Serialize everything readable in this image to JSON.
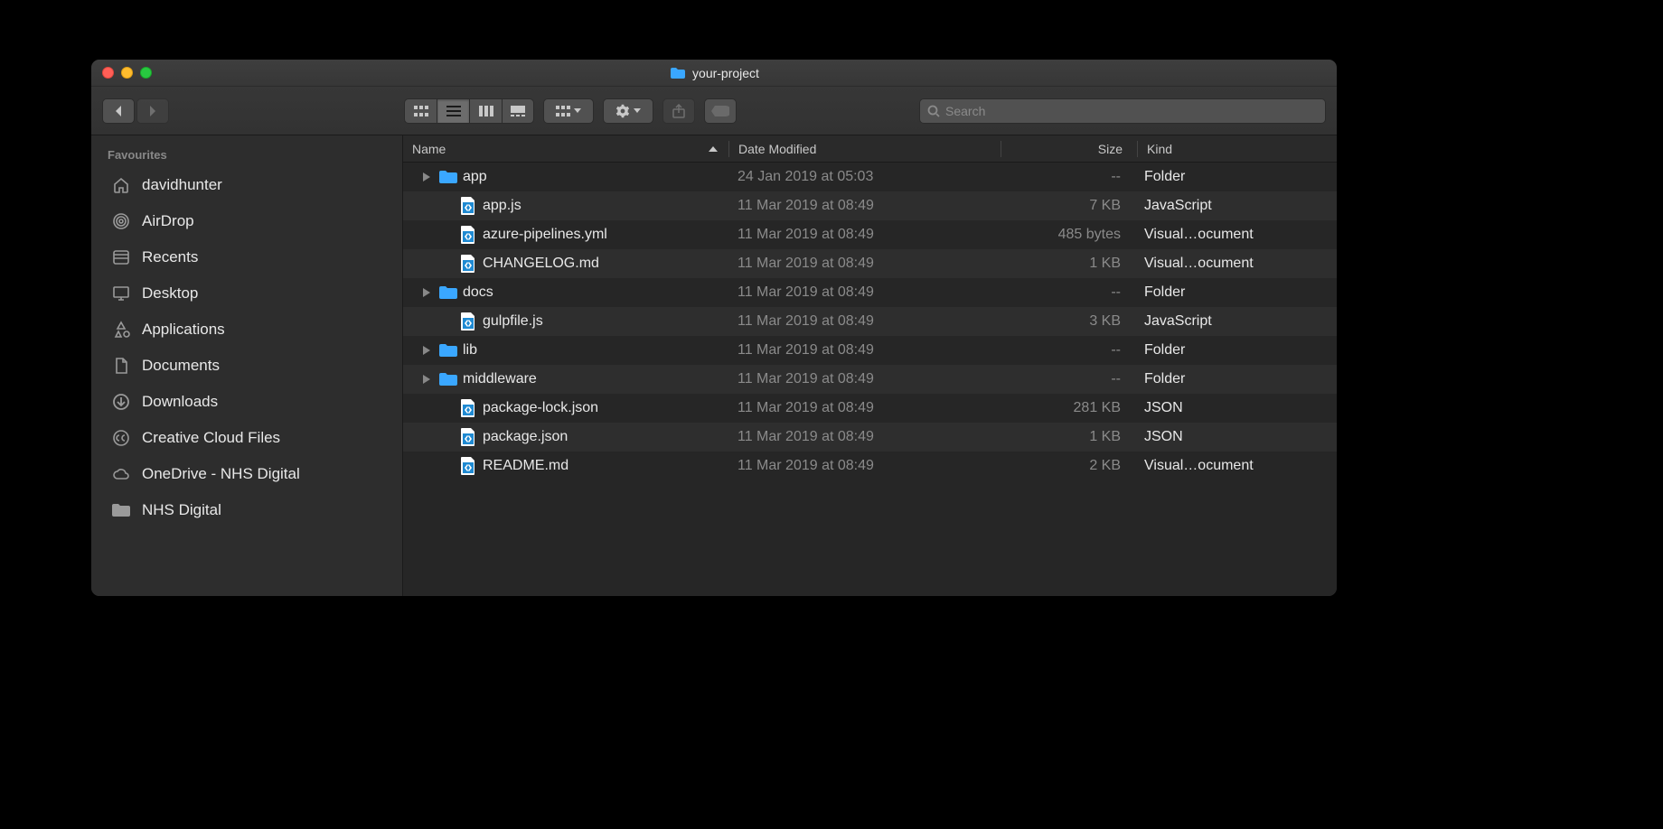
{
  "window": {
    "title": "your-project"
  },
  "search": {
    "placeholder": "Search"
  },
  "sidebar": {
    "heading": "Favourites",
    "items": [
      {
        "icon": "home",
        "label": "davidhunter"
      },
      {
        "icon": "airdrop",
        "label": "AirDrop"
      },
      {
        "icon": "recents",
        "label": "Recents"
      },
      {
        "icon": "desktop",
        "label": "Desktop"
      },
      {
        "icon": "apps",
        "label": "Applications"
      },
      {
        "icon": "documents",
        "label": "Documents"
      },
      {
        "icon": "downloads",
        "label": "Downloads"
      },
      {
        "icon": "cc",
        "label": "Creative Cloud Files"
      },
      {
        "icon": "cloud",
        "label": "OneDrive - NHS Digital"
      },
      {
        "icon": "folder",
        "label": "NHS Digital"
      }
    ]
  },
  "columns": {
    "name": "Name",
    "date": "Date Modified",
    "size": "Size",
    "kind": "Kind"
  },
  "files": [
    {
      "expandable": true,
      "icon": "folder",
      "name": "app",
      "date": "24 Jan 2019 at 05:03",
      "size": "--",
      "kind": "Folder"
    },
    {
      "expandable": false,
      "icon": "vscode",
      "name": "app.js",
      "date": "11 Mar 2019 at 08:49",
      "size": "7 KB",
      "kind": "JavaScript"
    },
    {
      "expandable": false,
      "icon": "vscode",
      "name": "azure-pipelines.yml",
      "date": "11 Mar 2019 at 08:49",
      "size": "485 bytes",
      "kind": "Visual…ocument"
    },
    {
      "expandable": false,
      "icon": "vscode",
      "name": "CHANGELOG.md",
      "date": "11 Mar 2019 at 08:49",
      "size": "1 KB",
      "kind": "Visual…ocument"
    },
    {
      "expandable": true,
      "icon": "folder",
      "name": "docs",
      "date": "11 Mar 2019 at 08:49",
      "size": "--",
      "kind": "Folder"
    },
    {
      "expandable": false,
      "icon": "vscode",
      "name": "gulpfile.js",
      "date": "11 Mar 2019 at 08:49",
      "size": "3 KB",
      "kind": "JavaScript"
    },
    {
      "expandable": true,
      "icon": "folder",
      "name": "lib",
      "date": "11 Mar 2019 at 08:49",
      "size": "--",
      "kind": "Folder"
    },
    {
      "expandable": true,
      "icon": "folder",
      "name": "middleware",
      "date": "11 Mar 2019 at 08:49",
      "size": "--",
      "kind": "Folder"
    },
    {
      "expandable": false,
      "icon": "vscode",
      "name": "package-lock.json",
      "date": "11 Mar 2019 at 08:49",
      "size": "281 KB",
      "kind": "JSON"
    },
    {
      "expandable": false,
      "icon": "vscode",
      "name": "package.json",
      "date": "11 Mar 2019 at 08:49",
      "size": "1 KB",
      "kind": "JSON"
    },
    {
      "expandable": false,
      "icon": "vscode",
      "name": "README.md",
      "date": "11 Mar 2019 at 08:49",
      "size": "2 KB",
      "kind": "Visual…ocument"
    }
  ]
}
